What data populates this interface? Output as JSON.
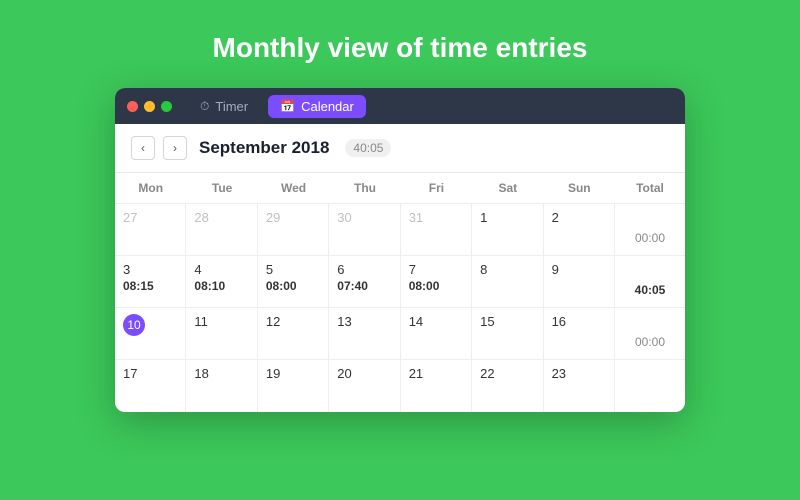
{
  "page": {
    "title": "Monthly view of time entries",
    "background": "#3cc85a"
  },
  "window": {
    "titlebar": {
      "dots": [
        "red",
        "yellow",
        "green"
      ],
      "tabs": [
        {
          "id": "timer",
          "label": "Timer",
          "icon": "⏱",
          "active": false
        },
        {
          "id": "calendar",
          "label": "Calendar",
          "icon": "📅",
          "active": true
        }
      ]
    },
    "header": {
      "prev_label": "‹",
      "next_label": "›",
      "month": "September 2018",
      "total": "40:05"
    },
    "calendar": {
      "columns": [
        "Mon",
        "Tue",
        "Wed",
        "Thu",
        "Fri",
        "Sat",
        "Sun",
        "Total"
      ],
      "weeks": [
        {
          "days": [
            {
              "num": "27",
              "current": false,
              "today": false,
              "time": ""
            },
            {
              "num": "28",
              "current": false,
              "today": false,
              "time": ""
            },
            {
              "num": "29",
              "current": false,
              "today": false,
              "time": ""
            },
            {
              "num": "30",
              "current": false,
              "today": false,
              "time": ""
            },
            {
              "num": "31",
              "current": false,
              "today": false,
              "time": ""
            },
            {
              "num": "1",
              "current": true,
              "today": false,
              "time": ""
            },
            {
              "num": "2",
              "current": true,
              "today": false,
              "time": ""
            }
          ],
          "total": "00:00"
        },
        {
          "days": [
            {
              "num": "3",
              "current": true,
              "today": false,
              "time": "08:15"
            },
            {
              "num": "4",
              "current": true,
              "today": false,
              "time": "08:10"
            },
            {
              "num": "5",
              "current": true,
              "today": false,
              "time": "08:00"
            },
            {
              "num": "6",
              "current": true,
              "today": false,
              "time": "07:40"
            },
            {
              "num": "7",
              "current": true,
              "today": false,
              "time": "08:00"
            },
            {
              "num": "8",
              "current": true,
              "today": false,
              "time": ""
            },
            {
              "num": "9",
              "current": true,
              "today": false,
              "time": ""
            }
          ],
          "total": "40:05",
          "total_highlight": true
        },
        {
          "days": [
            {
              "num": "10",
              "current": true,
              "today": true,
              "time": ""
            },
            {
              "num": "11",
              "current": true,
              "today": false,
              "time": ""
            },
            {
              "num": "12",
              "current": true,
              "today": false,
              "time": ""
            },
            {
              "num": "13",
              "current": true,
              "today": false,
              "time": ""
            },
            {
              "num": "14",
              "current": true,
              "today": false,
              "time": ""
            },
            {
              "num": "15",
              "current": true,
              "today": false,
              "time": ""
            },
            {
              "num": "16",
              "current": true,
              "today": false,
              "time": ""
            }
          ],
          "total": "00:00"
        },
        {
          "days": [
            {
              "num": "17",
              "current": true,
              "today": false,
              "time": ""
            },
            {
              "num": "18",
              "current": true,
              "today": false,
              "time": ""
            },
            {
              "num": "19",
              "current": true,
              "today": false,
              "time": ""
            },
            {
              "num": "20",
              "current": true,
              "today": false,
              "time": ""
            },
            {
              "num": "21",
              "current": true,
              "today": false,
              "time": ""
            },
            {
              "num": "22",
              "current": true,
              "today": false,
              "time": ""
            },
            {
              "num": "23",
              "current": true,
              "today": false,
              "time": ""
            }
          ],
          "total": ""
        }
      ]
    }
  }
}
